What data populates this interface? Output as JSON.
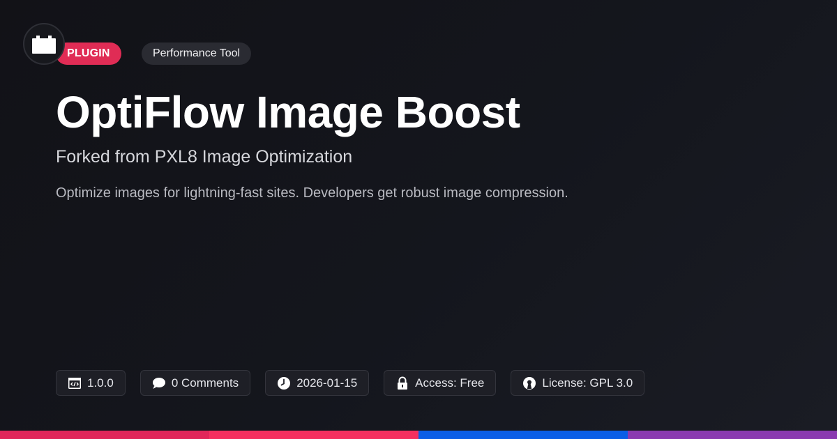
{
  "badges": {
    "type": "PLUGIN",
    "category": "Performance Tool"
  },
  "title": "OptiFlow Image Boost",
  "subtitle": "Forked from PXL8 Image Optimization",
  "description": "Optimize images for lightning-fast sites. Developers get robust image compression.",
  "meta": {
    "version": "1.0.0",
    "comments": "0 Comments",
    "date": "2026-01-15",
    "access": "Access: Free",
    "license": "License: GPL 3.0"
  },
  "icons": {
    "logo": "plugin-block-icon",
    "version": "code-window-icon",
    "comments": "speech-bubble-icon",
    "date": "clock-icon",
    "access": "lock-icon",
    "license": "open-source-icon"
  },
  "colors": {
    "accent": "#e02c55",
    "background": "#14161d",
    "stripe": [
      "#e0265a",
      "#f4305f",
      "#0a5ee6",
      "#8a3ab0"
    ]
  }
}
